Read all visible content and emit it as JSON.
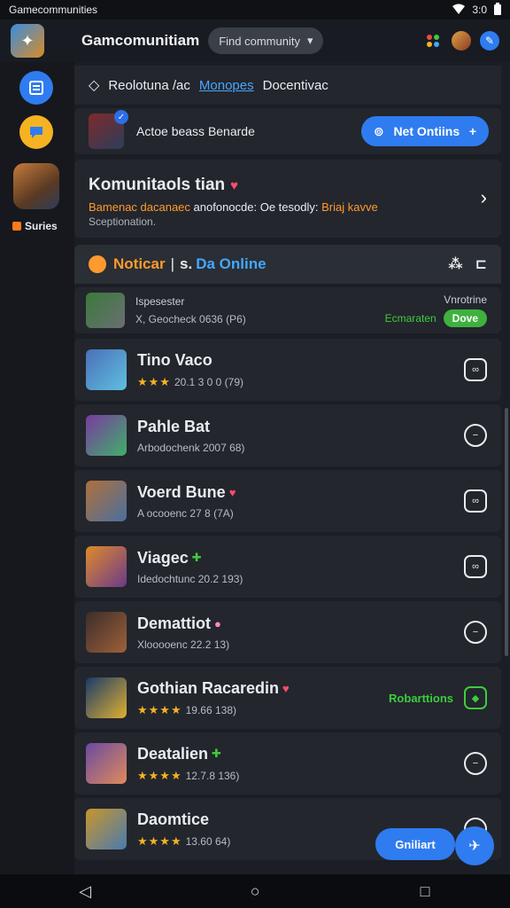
{
  "status_bar": {
    "app_name": "Gamecommunities",
    "time": "3:0",
    "icons": [
      "wifi-icon",
      "battery-icon"
    ]
  },
  "header": {
    "title": "Gamcomunitiam",
    "search_chip": "Find community",
    "icons": [
      "puzzle-icon",
      "profile-avatar",
      "compass-icon"
    ]
  },
  "sidebar": {
    "label": "Suries",
    "items": [
      "news-icon",
      "chat-bubble-icon",
      "game-thumb"
    ]
  },
  "breadcrumb": {
    "first": "Reolotuna /ac",
    "link": "Monopes",
    "last": "Docentivac"
  },
  "online_card": {
    "label": "Actoe beass Benarde",
    "button_label": "Net Ontiins",
    "button_plus": "+"
  },
  "community_card": {
    "title": "Komunitaols tian",
    "desc_orange_1": "Bamenac dacanaec",
    "desc_white": "anofonocde: Oe tesodly:",
    "desc_orange_2": "Briaj kavve",
    "sub": "Sceptionation."
  },
  "section_header": {
    "notice": "Noticar",
    "separator": "|",
    "prefix": "s.",
    "online": "Da Online"
  },
  "partial_row": {
    "line1": "Ispesester",
    "line2": "X, Geocheck 0636 (P6)",
    "right_top": "Vnrotrine",
    "right_status": "Ecmaraten",
    "right_pill": "Dove"
  },
  "rows": [
    {
      "title": "Tino Vaco",
      "stars": "★★★",
      "meta": "20.1 3 0 0 (79)",
      "badge": "",
      "action": "link",
      "status": ""
    },
    {
      "title": "Pahle Bat",
      "stars": "",
      "meta": "Arbodochenk 2007 68)",
      "badge": "",
      "action": "minus",
      "status": ""
    },
    {
      "title": "Voerd Bune",
      "stars": "",
      "meta": "A ocooenc 27 8 (7A)",
      "badge": "♥",
      "action": "link",
      "status": ""
    },
    {
      "title": "Viagec",
      "stars": "",
      "meta": "Idedochtunc 20.2 193)",
      "badge": "✚",
      "action": "link",
      "status": ""
    },
    {
      "title": "Demattiot",
      "stars": "",
      "meta": "Xlooooenc 22.2 13)",
      "badge": "●",
      "action": "minus",
      "status": ""
    },
    {
      "title": "Gothian Racaredin",
      "stars": "★★★★",
      "meta": "19.66 138)",
      "badge": "♥",
      "action": "green",
      "status": "Robarttions"
    },
    {
      "title": "Deatalien",
      "stars": "★★★★",
      "meta": "12.7.8 136)",
      "badge": "✚",
      "action": "minus",
      "status": ""
    },
    {
      "title": "Daomtice",
      "stars": "★★★★",
      "meta": "13.60 64)",
      "badge": "",
      "action": "minus",
      "status": ""
    }
  ],
  "fab": {
    "label": "Gniliart"
  }
}
